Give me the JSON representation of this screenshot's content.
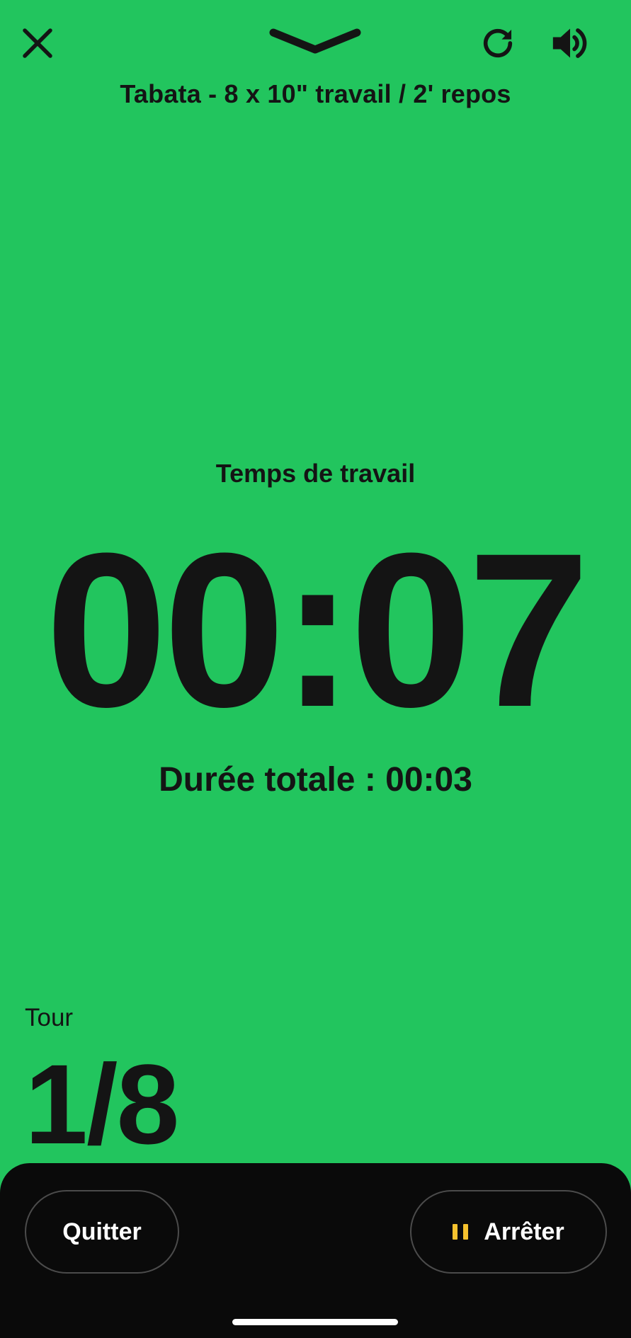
{
  "header": {
    "close_icon": "close-icon",
    "collapse_icon": "chevron-down-icon",
    "refresh_icon": "refresh-icon",
    "sound_icon": "volume-icon",
    "title": "Tabata - 8 x 10\" travail / 2' repos"
  },
  "timer": {
    "phase_label": "Temps de travail",
    "time": "00:07",
    "total_label": "Durée totale : 00:03"
  },
  "round": {
    "label": "Tour",
    "value": "1/8"
  },
  "actions": {
    "quit_label": "Quitter",
    "stop_label": "Arrêter",
    "stop_icon": "pause-icon"
  },
  "colors": {
    "background": "#22c55e",
    "text": "#141414",
    "bottom_bar": "#0a0a0a",
    "pause_accent": "#f6c22e"
  }
}
